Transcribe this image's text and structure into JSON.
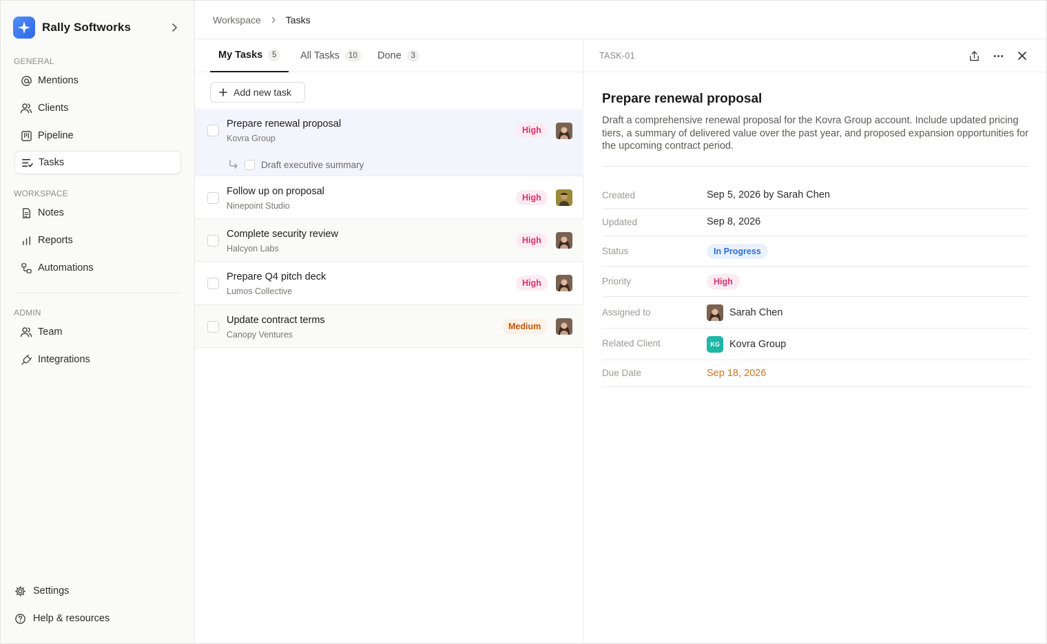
{
  "brand": {
    "name": "Rally Softworks"
  },
  "sidebar": {
    "general_label": "GENERAL",
    "workspace_label": "WORKSPACE",
    "admin_label": "ADMIN",
    "general": [
      {
        "label": "Mentions",
        "icon": "at-icon"
      },
      {
        "label": "Clients",
        "icon": "users-icon"
      },
      {
        "label": "Pipeline",
        "icon": "kanban-icon"
      },
      {
        "label": "Tasks",
        "icon": "tasks-icon",
        "active": true
      }
    ],
    "workspace": [
      {
        "label": "Notes",
        "icon": "document-icon"
      },
      {
        "label": "Reports",
        "icon": "bar-chart-icon"
      },
      {
        "label": "Automations",
        "icon": "workflow-icon"
      }
    ],
    "admin": [
      {
        "label": "Team",
        "icon": "users-icon"
      },
      {
        "label": "Integrations",
        "icon": "plug-icon"
      }
    ],
    "footer": [
      {
        "label": "Settings",
        "icon": "gear-icon"
      },
      {
        "label": "Help & resources",
        "icon": "help-icon"
      }
    ]
  },
  "breadcrumb": {
    "parent": "Workspace",
    "current": "Tasks"
  },
  "tabs": [
    {
      "label": "My Tasks",
      "count": "5",
      "active": true
    },
    {
      "label": "All Tasks",
      "count": "10"
    },
    {
      "label": "Done",
      "count": "3"
    }
  ],
  "add_task_label": "Add new task",
  "tasks": [
    {
      "title": "Prepare renewal proposal",
      "client": "Kovra Group",
      "priority": "High",
      "subtask": "Draft executive summary"
    },
    {
      "title": "Follow up on proposal",
      "client": "Ninepoint Studio",
      "priority": "High"
    },
    {
      "title": "Complete security review",
      "client": "Halcyon Labs",
      "priority": "High"
    },
    {
      "title": "Prepare Q4 pitch deck",
      "client": "Lumos Collective",
      "priority": "High"
    },
    {
      "title": "Update contract terms",
      "client": "Canopy Ventures",
      "priority": "Medium"
    }
  ],
  "detail": {
    "id": "TASK-01",
    "title": "Prepare renewal proposal",
    "description": "Draft a comprehensive renewal proposal for the Kovra Group account. Include updated pricing tiers, a summary of delivered value over the past year, and proposed expansion opportunities for the upcoming contract period.",
    "props": {
      "created_label": "Created",
      "created": "Sep 5, 2026 by Sarah Chen",
      "updated_label": "Updated",
      "updated": "Sep 8, 2026",
      "status_label": "Status",
      "status": "In Progress",
      "priority_label": "Priority",
      "priority": "High",
      "assigned_label": "Assigned to",
      "assigned": "Sarah Chen",
      "client_label": "Related Client",
      "client": "Kovra Group",
      "client_initials": "KG",
      "due_label": "Due Date",
      "due": "Sep 18, 2026"
    }
  },
  "colors": {
    "accent": "#2f66e8",
    "high": "#d6336c",
    "medium": "#c2570c",
    "status": "#2f6fdc",
    "due": "#d4731f",
    "client_badge": "#1fb6a6"
  }
}
